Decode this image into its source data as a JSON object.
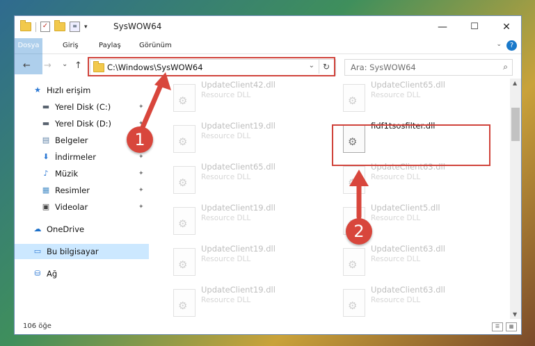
{
  "window": {
    "title": "SysWOW64",
    "minimize": "—",
    "maximize": "☐",
    "close": "✕"
  },
  "quick_access_toolbar": {
    "dropdown": "▾"
  },
  "ribbon": {
    "tabs": [
      "Dosya",
      "Giriş",
      "Paylaş",
      "Görünüm"
    ],
    "help": "?",
    "collapse": "⌄"
  },
  "nav_buttons": {
    "back": "←",
    "forward": "→",
    "recent": "⌄",
    "up": "↑"
  },
  "address_bar": {
    "path": "C:\\Windows\\SysWOW64",
    "dropdown": "⌄",
    "refresh": "↻"
  },
  "search": {
    "placeholder": "Ara: SysWOW64",
    "icon": "search-icon"
  },
  "sidebar": {
    "items": [
      {
        "label": "Hızlı erişim",
        "icon": "star-icon",
        "glyph": "★",
        "color": "#2b78d4",
        "pinned": false
      },
      {
        "label": "Yerel Disk (C:)",
        "icon": "drive-icon",
        "glyph": "▬",
        "color": "#5a6470",
        "pinned": true
      },
      {
        "label": "Yerel Disk (D:)",
        "icon": "drive-icon",
        "glyph": "▬",
        "color": "#5a6470",
        "pinned": true
      },
      {
        "label": "Belgeler",
        "icon": "documents-icon",
        "glyph": "▤",
        "color": "#5b7fa6",
        "pinned": true
      },
      {
        "label": "İndirmeler",
        "icon": "download-icon",
        "glyph": "⬇",
        "color": "#2b78d4",
        "pinned": true
      },
      {
        "label": "Müzik",
        "icon": "music-icon",
        "glyph": "♪",
        "color": "#2b78d4",
        "pinned": true
      },
      {
        "label": "Resimler",
        "icon": "pictures-icon",
        "glyph": "▦",
        "color": "#4a8fc8",
        "pinned": true
      },
      {
        "label": "Videolar",
        "icon": "videos-icon",
        "glyph": "▣",
        "color": "#444",
        "pinned": true
      },
      {
        "label": "OneDrive",
        "icon": "cloud-icon",
        "glyph": "☁",
        "color": "#1b6fc9",
        "pinned": false
      },
      {
        "label": "Bu bilgisayar",
        "icon": "computer-icon",
        "glyph": "▭",
        "color": "#2b78d4",
        "pinned": false,
        "selected": true
      },
      {
        "label": "Ağ",
        "icon": "network-icon",
        "glyph": "⛁",
        "color": "#2b78d4",
        "pinned": false
      }
    ],
    "pin_glyph": "📌"
  },
  "files": [
    {
      "name": "UpdateClient42.dll",
      "type": "Resource DLL"
    },
    {
      "name": "UpdateClient65.dll",
      "type": "Resource DLL"
    },
    {
      "name": "UpdateClient19.dll",
      "type": "Resource DLL"
    },
    {
      "name": "fidf1tsosfilter.dll",
      "type": "",
      "highlighted": true
    },
    {
      "name": "UpdateClient65.dll",
      "type": "Resource DLL"
    },
    {
      "name": "UpdateClient63.dll",
      "type": "Resource DLL"
    },
    {
      "name": "UpdateClient19.dll",
      "type": "Resource DLL"
    },
    {
      "name": "UpdateClient5.dll",
      "type": "Resource DLL"
    },
    {
      "name": "UpdateClient19.dll",
      "type": "Resource DLL"
    },
    {
      "name": "UpdateClient63.dll",
      "type": "Resource DLL"
    },
    {
      "name": "UpdateClient19.dll",
      "type": "Resource DLL"
    },
    {
      "name": "UpdateClient63.dll",
      "type": "Resource DLL"
    }
  ],
  "status_bar": {
    "item_count": "106 öğe"
  },
  "annotations": {
    "step1": "1",
    "step2": "2",
    "color": "#d8463c"
  }
}
